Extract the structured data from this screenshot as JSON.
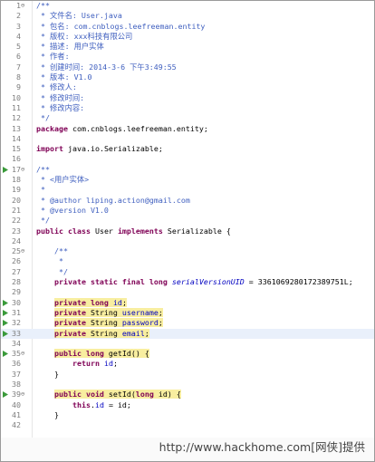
{
  "editor": {
    "lines": [
      {
        "n": "1",
        "fold": "⊖",
        "marker": "none",
        "segments": [
          {
            "t": "/**",
            "c": "jd"
          }
        ]
      },
      {
        "n": "2",
        "segments": [
          {
            "t": " * 文件名: User.java",
            "c": "jd"
          }
        ]
      },
      {
        "n": "3",
        "segments": [
          {
            "t": " * 包名: com.cnblogs.leefreeman.entity",
            "c": "jd"
          }
        ]
      },
      {
        "n": "4",
        "segments": [
          {
            "t": " * 版权: xxx科技有限公司",
            "c": "jd"
          }
        ]
      },
      {
        "n": "5",
        "segments": [
          {
            "t": " * 描述: 用户实体",
            "c": "jd"
          }
        ]
      },
      {
        "n": "6",
        "segments": [
          {
            "t": " * 作者:",
            "c": "jd"
          }
        ]
      },
      {
        "n": "7",
        "segments": [
          {
            "t": " * 创建时间: 2014-3-6 下午3:49:55",
            "c": "jd"
          }
        ]
      },
      {
        "n": "8",
        "segments": [
          {
            "t": " * 版本: V1.0",
            "c": "jd"
          }
        ]
      },
      {
        "n": "9",
        "segments": [
          {
            "t": " * 修改人:",
            "c": "jd"
          }
        ]
      },
      {
        "n": "10",
        "segments": [
          {
            "t": " * 修改时间:",
            "c": "jd"
          }
        ]
      },
      {
        "n": "11",
        "segments": [
          {
            "t": " * 修改内容:",
            "c": "jd"
          }
        ]
      },
      {
        "n": "12",
        "segments": [
          {
            "t": " */",
            "c": "jd"
          }
        ]
      },
      {
        "n": "13",
        "segments": [
          {
            "t": "package",
            "c": "kw"
          },
          {
            "t": " com.cnblogs.leefreeman.entity;",
            "c": ""
          }
        ]
      },
      {
        "n": "14",
        "segments": []
      },
      {
        "n": "15",
        "segments": [
          {
            "t": "import",
            "c": "kw"
          },
          {
            "t": " java.io.Serializable;",
            "c": ""
          }
        ]
      },
      {
        "n": "16",
        "segments": []
      },
      {
        "n": "17",
        "fold": "⊖",
        "marker": "arrow",
        "segments": [
          {
            "t": "/**",
            "c": "jd"
          }
        ]
      },
      {
        "n": "18",
        "segments": [
          {
            "t": " * <用户实体>",
            "c": "jd"
          }
        ]
      },
      {
        "n": "19",
        "segments": [
          {
            "t": " *",
            "c": "jd"
          }
        ]
      },
      {
        "n": "20",
        "segments": [
          {
            "t": " * @author liping.action@gmail.com",
            "c": "jd"
          }
        ]
      },
      {
        "n": "21",
        "segments": [
          {
            "t": " * @version V1.0",
            "c": "jd"
          }
        ]
      },
      {
        "n": "22",
        "segments": [
          {
            "t": " */",
            "c": "jd"
          }
        ]
      },
      {
        "n": "23",
        "segments": [
          {
            "t": "public class",
            "c": "kw"
          },
          {
            "t": " User ",
            "c": ""
          },
          {
            "t": "implements",
            "c": "kw"
          },
          {
            "t": " Serializable {",
            "c": ""
          }
        ]
      },
      {
        "n": "24",
        "segments": []
      },
      {
        "n": "25",
        "fold": "⊖",
        "segments": [
          {
            "t": "    /**",
            "c": "jd"
          }
        ]
      },
      {
        "n": "26",
        "segments": [
          {
            "t": "     *",
            "c": "jd"
          }
        ]
      },
      {
        "n": "27",
        "segments": [
          {
            "t": "     */",
            "c": "jd"
          }
        ]
      },
      {
        "n": "28",
        "segments": [
          {
            "t": "    ",
            "c": ""
          },
          {
            "t": "private static final long",
            "c": "kw"
          },
          {
            "t": " ",
            "c": ""
          },
          {
            "t": "serialVersionUID",
            "c": "sfld"
          },
          {
            "t": " = 3361069280172389751L;",
            "c": ""
          }
        ]
      },
      {
        "n": "29",
        "segments": []
      },
      {
        "n": "30",
        "marker": "arrow",
        "segments": [
          {
            "t": "    ",
            "c": ""
          },
          {
            "t": "private long",
            "c": "kw hl"
          },
          {
            "t": " ",
            "c": "hl"
          },
          {
            "t": "id",
            "c": "fld hl"
          },
          {
            "t": ";",
            "c": "hl"
          }
        ]
      },
      {
        "n": "31",
        "marker": "arrow",
        "segments": [
          {
            "t": "    ",
            "c": ""
          },
          {
            "t": "private",
            "c": "kw hl"
          },
          {
            "t": " String ",
            "c": "hl"
          },
          {
            "t": "username",
            "c": "fld hl"
          },
          {
            "t": ";",
            "c": "hl"
          }
        ]
      },
      {
        "n": "32",
        "marker": "arrow",
        "segments": [
          {
            "t": "    ",
            "c": ""
          },
          {
            "t": "private",
            "c": "kw hl"
          },
          {
            "t": " String ",
            "c": "hl"
          },
          {
            "t": "password",
            "c": "fld hl"
          },
          {
            "t": ";",
            "c": "hl"
          }
        ]
      },
      {
        "n": "33",
        "marker": "arrow",
        "current": true,
        "segments": [
          {
            "t": "    ",
            "c": ""
          },
          {
            "t": "private",
            "c": "kw hl"
          },
          {
            "t": " String ",
            "c": "hl"
          },
          {
            "t": "email",
            "c": "fld hl"
          },
          {
            "t": ";",
            "c": "hl"
          }
        ]
      },
      {
        "n": "34",
        "segments": []
      },
      {
        "n": "35",
        "fold": "⊖",
        "marker": "arrow",
        "segments": [
          {
            "t": "    ",
            "c": ""
          },
          {
            "t": "public long",
            "c": "kw hl"
          },
          {
            "t": " getId() {",
            "c": "hl"
          }
        ]
      },
      {
        "n": "36",
        "segments": [
          {
            "t": "        ",
            "c": ""
          },
          {
            "t": "return",
            "c": "kw"
          },
          {
            "t": " ",
            "c": ""
          },
          {
            "t": "id",
            "c": "fld"
          },
          {
            "t": ";",
            "c": ""
          }
        ]
      },
      {
        "n": "37",
        "segments": [
          {
            "t": "    }",
            "c": ""
          }
        ]
      },
      {
        "n": "38",
        "segments": []
      },
      {
        "n": "39",
        "fold": "⊖",
        "marker": "arrow",
        "segments": [
          {
            "t": "    ",
            "c": ""
          },
          {
            "t": "public void",
            "c": "kw hl"
          },
          {
            "t": " setId(",
            "c": "hl"
          },
          {
            "t": "long",
            "c": "kw hl"
          },
          {
            "t": " id) {",
            "c": "hl"
          }
        ]
      },
      {
        "n": "40",
        "segments": [
          {
            "t": "        ",
            "c": ""
          },
          {
            "t": "this",
            "c": "kw"
          },
          {
            "t": ".",
            "c": ""
          },
          {
            "t": "id",
            "c": "fld"
          },
          {
            "t": " = id;",
            "c": ""
          }
        ]
      },
      {
        "n": "41",
        "segments": [
          {
            "t": "    }",
            "c": ""
          }
        ]
      },
      {
        "n": "42",
        "segments": []
      }
    ]
  },
  "watermark": {
    "text": "http://www.hackhome.com[网侠]提供"
  },
  "colors": {
    "keyword": "#7f0055",
    "javadoc": "#3f5fbf",
    "field": "#0000c0",
    "highlight": "#f8eea0",
    "current_line": "#e9f0fb",
    "line_number": "#7d7d7d"
  }
}
